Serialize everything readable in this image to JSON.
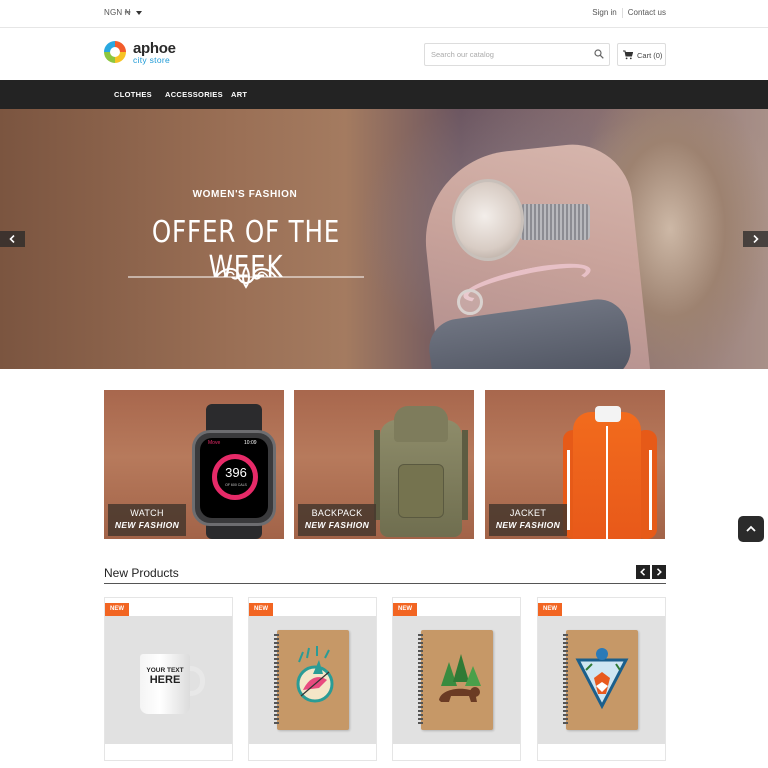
{
  "topbar": {
    "currency": "NGN ₦",
    "sign_in": "Sign in",
    "contact": "Contact us"
  },
  "header": {
    "logo_name": "aphoe",
    "logo_sub": "city store",
    "search_placeholder": "Search our catalog",
    "cart_label": "Cart (0)"
  },
  "nav": {
    "items": [
      {
        "label": "CLOTHES"
      },
      {
        "label": "ACCESSORIES"
      },
      {
        "label": "ART"
      }
    ]
  },
  "hero": {
    "kicker": "WOMEN'S FASHION",
    "title": "OFFER OF THE WEEK"
  },
  "categories": [
    {
      "name": "WATCH",
      "sub": "NEW FASHION"
    },
    {
      "name": "BACKPACK",
      "sub": "NEW FASHION"
    },
    {
      "name": "JACKET",
      "sub": "NEW FASHION"
    }
  ],
  "watch_screen": {
    "app": "Move",
    "time": "10:09",
    "value": "396",
    "caption": "OF 600 CALS"
  },
  "mug_print": {
    "line1": "YOUR TEXT",
    "line2": "HERE"
  },
  "new_products": {
    "title": "New Products",
    "badge": "NEW",
    "items": [
      {
        "kind": "mug"
      },
      {
        "kind": "notebook-hummingbird"
      },
      {
        "kind": "notebook-bear"
      },
      {
        "kind": "notebook-fox"
      }
    ]
  },
  "colors": {
    "nav_bg": "#232323",
    "badge": "#f26522",
    "accent_blue": "#1e9ad6"
  }
}
